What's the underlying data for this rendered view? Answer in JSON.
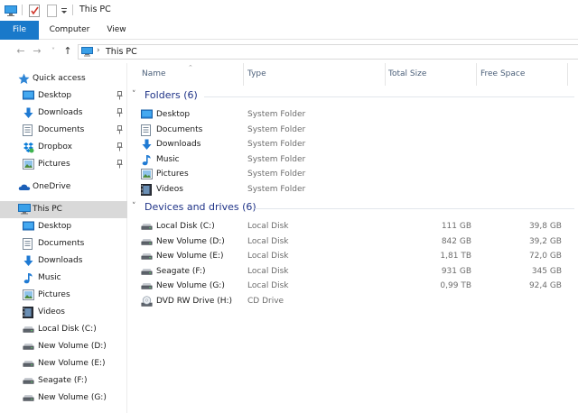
{
  "window": {
    "title": "This PC"
  },
  "ribbon": {
    "tabs": [
      "File",
      "Computer",
      "View"
    ]
  },
  "address": {
    "path": "This PC"
  },
  "nav": {
    "quick_access": "Quick access",
    "quick_items": [
      {
        "label": "Desktop",
        "icon": "desktop-icon"
      },
      {
        "label": "Downloads",
        "icon": "download-icon"
      },
      {
        "label": "Documents",
        "icon": "documents-icon"
      },
      {
        "label": "Dropbox",
        "icon": "dropbox-icon"
      },
      {
        "label": "Pictures",
        "icon": "pictures-icon"
      }
    ],
    "onedrive": "OneDrive",
    "this_pc": "This PC",
    "pc_items": [
      {
        "label": "Desktop",
        "icon": "desktop-icon"
      },
      {
        "label": "Documents",
        "icon": "documents-icon"
      },
      {
        "label": "Downloads",
        "icon": "download-icon"
      },
      {
        "label": "Music",
        "icon": "music-icon"
      },
      {
        "label": "Pictures",
        "icon": "pictures-icon"
      },
      {
        "label": "Videos",
        "icon": "videos-icon"
      },
      {
        "label": "Local Disk (C:)",
        "icon": "drive-icon"
      },
      {
        "label": "New Volume (D:)",
        "icon": "drive-icon"
      },
      {
        "label": "New Volume (E:)",
        "icon": "drive-icon"
      },
      {
        "label": "Seagate (F:)",
        "icon": "drive-icon"
      },
      {
        "label": "New Volume (G:)",
        "icon": "drive-icon"
      }
    ]
  },
  "columns": {
    "name": "Name",
    "type": "Type",
    "total": "Total Size",
    "free": "Free Space"
  },
  "folders": {
    "title": "Folders (6)",
    "items": [
      {
        "name": "Desktop",
        "type": "System Folder",
        "icon": "desktop-icon"
      },
      {
        "name": "Documents",
        "type": "System Folder",
        "icon": "documents-icon"
      },
      {
        "name": "Downloads",
        "type": "System Folder",
        "icon": "download-icon"
      },
      {
        "name": "Music",
        "type": "System Folder",
        "icon": "music-icon"
      },
      {
        "name": "Pictures",
        "type": "System Folder",
        "icon": "pictures-icon"
      },
      {
        "name": "Videos",
        "type": "System Folder",
        "icon": "videos-icon"
      }
    ]
  },
  "drives": {
    "title": "Devices and drives (6)",
    "items": [
      {
        "name": "Local Disk (C:)",
        "type": "Local Disk",
        "total": "111 GB",
        "free": "39,8 GB",
        "icon": "drive-icon"
      },
      {
        "name": "New Volume (D:)",
        "type": "Local Disk",
        "total": "842 GB",
        "free": "39,2 GB",
        "icon": "drive-icon"
      },
      {
        "name": "New Volume (E:)",
        "type": "Local Disk",
        "total": "1,81 TB",
        "free": "72,0 GB",
        "icon": "drive-icon"
      },
      {
        "name": "Seagate (F:)",
        "type": "Local Disk",
        "total": "931 GB",
        "free": "345 GB",
        "icon": "drive-icon"
      },
      {
        "name": "New Volume (G:)",
        "type": "Local Disk",
        "total": "0,99 TB",
        "free": "92,4 GB",
        "icon": "drive-icon"
      },
      {
        "name": "DVD RW Drive (H:)",
        "type": "CD Drive",
        "total": "",
        "free": "",
        "icon": "dvd-drive-icon"
      }
    ]
  }
}
